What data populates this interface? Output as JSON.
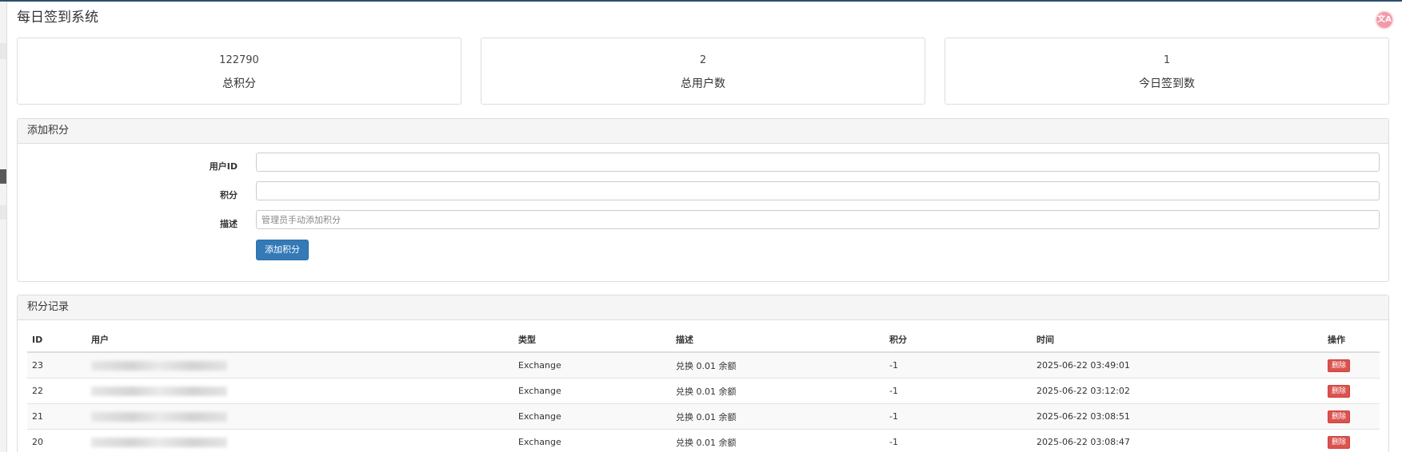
{
  "header": {
    "title": "每日签到系统",
    "badge": "文A"
  },
  "stats": [
    {
      "value": "122790",
      "label": "总积分"
    },
    {
      "value": "2",
      "label": "总用户数"
    },
    {
      "value": "1",
      "label": "今日签到数"
    }
  ],
  "add_panel": {
    "title": "添加积分",
    "user_id_label": "用户ID",
    "user_id_value": "",
    "points_label": "积分",
    "points_value": "",
    "desc_label": "描述",
    "desc_placeholder": "管理员手动添加积分",
    "submit_label": "添加积分"
  },
  "log_panel": {
    "title": "积分记录",
    "columns": [
      "ID",
      "用户",
      "类型",
      "描述",
      "积分",
      "时间",
      "操作"
    ],
    "rows": [
      {
        "id": "23",
        "type": "Exchange",
        "desc": "兑换 0.01 余额",
        "points": "-1",
        "time": "2025-06-22 03:49:01",
        "action": "删除"
      },
      {
        "id": "22",
        "type": "Exchange",
        "desc": "兑换 0.01 余额",
        "points": "-1",
        "time": "2025-06-22 03:12:02",
        "action": "删除"
      },
      {
        "id": "21",
        "type": "Exchange",
        "desc": "兑换 0.01 余额",
        "points": "-1",
        "time": "2025-06-22 03:08:51",
        "action": "删除"
      },
      {
        "id": "20",
        "type": "Exchange",
        "desc": "兑换 0.01 余额",
        "points": "-1",
        "time": "2025-06-22 03:08:47",
        "action": "删除"
      }
    ]
  },
  "colors": {
    "primary": "#337ab7",
    "danger": "#d9534f",
    "negative_points": "#c9302c",
    "topbar": "#2d4d72"
  }
}
